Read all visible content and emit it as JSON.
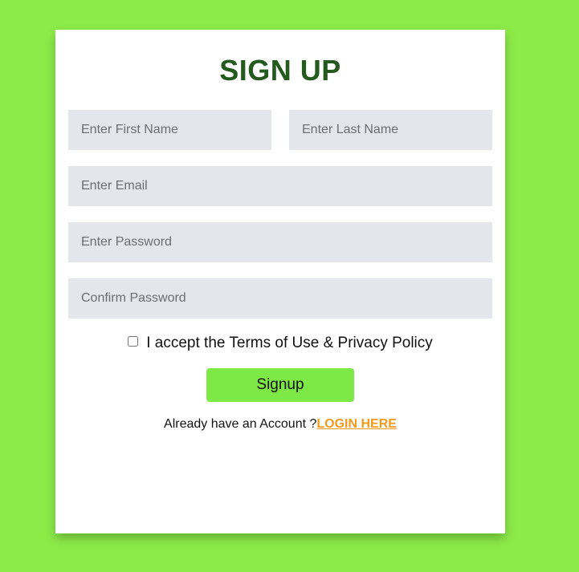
{
  "form": {
    "title": "SIGN UP",
    "first_name_placeholder": "Enter First Name",
    "last_name_placeholder": "Enter Last Name",
    "email_placeholder": "Enter Email",
    "password_placeholder": "Enter Password",
    "confirm_password_placeholder": "Confirm Password",
    "terms_label": "I accept the Terms of Use & Privacy Policy",
    "terms_checked": false,
    "signup_label": "Signup",
    "login_prompt": "Already have an Account ?",
    "login_link": "LOGIN HERE"
  },
  "colors": {
    "page_background": "#8ceb48",
    "card_background": "#ffffff",
    "title": "#245a1e",
    "input_background": "#e3e6ea",
    "button_background": "#7ee846",
    "link": "#f29a1c"
  }
}
